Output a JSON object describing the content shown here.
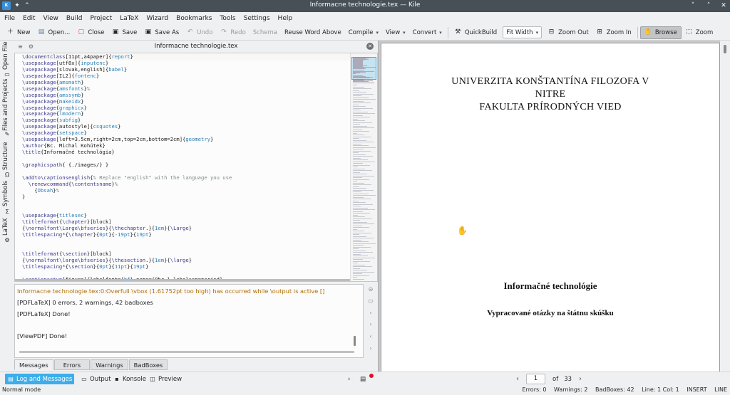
{
  "window": {
    "title": "Informacne technologie.tex — Kile",
    "app_icon": "K",
    "pin_icon": "✦",
    "up_icon": "⌃",
    "controls": [
      "˅",
      "˄",
      "✕"
    ]
  },
  "menu": [
    "File",
    "Edit",
    "View",
    "Build",
    "Project",
    "LaTeX",
    "Wizard",
    "Bookmarks",
    "Tools",
    "Settings",
    "Help"
  ],
  "toolbar": {
    "new": "New",
    "open": "Open...",
    "close": "Close",
    "save": "Save",
    "save_as": "Save As",
    "undo": "Undo",
    "redo": "Redo",
    "schema": "Schema",
    "reuse_word_above": "Reuse Word Above",
    "compile": "Compile",
    "view": "View",
    "convert": "Convert",
    "quickbuild": "QuickBuild",
    "fit_width": "Fit Width",
    "zoom_out": "Zoom Out",
    "zoom_in": "Zoom In",
    "browse": "Browse",
    "zoom": "Zoom"
  },
  "side_tabs": [
    "Open File",
    "Files and Projects",
    "Structure",
    "Symbols",
    "LaTeX"
  ],
  "editor": {
    "tab_title": "Informacne technologie.tex"
  },
  "code_lines": [
    "\\documentclass[11pt,a4paper]{report}",
    "\\usepackage[utf8x]{inputenc}",
    "\\usepackage[slovak,english]{babel}",
    "\\usepackage[IL2]{fontenc}",
    "\\usepackage{amsmath}",
    "\\usepackage{amsfonts}%",
    "\\usepackage{amssymb}",
    "\\usepackage{makeidx}",
    "\\usepackage{graphicx}",
    "\\usepackage{lmodern}",
    "\\usepackage{subfig}",
    "\\usepackage[autostyle]{csquotes}",
    "\\usepackage{setspace}",
    "\\usepackage[left=3.5cm,right=2cm,top=2cm,bottom=2cm]{geometry}",
    "\\author{Bc. Michal Kohútek}",
    "\\title{Informačné technológia}",
    "",
    "\\graphicspath{ {./images/} }",
    "",
    "\\addto\\captionsenglish{% Replace \"english\" with the language you use",
    "  \\renewcommand{\\contentsname}%",
    "    {Obsah}%",
    "}",
    "",
    "",
    "\\usepackage{titlesec}",
    "\\titleformat{\\chapter}[block]",
    "{\\normalfont\\Large\\bfseries}{\\thechapter.}{1em}{\\Large}",
    "\\titlespacing*{\\chapter}{0pt}{-19pt}{19pt}",
    "",
    "",
    "\\titleformat{\\section}[block]",
    "{\\normalfont\\large\\bfseries}{\\thesection.}{1em}{\\large}",
    "\\titlespacing*{\\section}{0pt}{11pt}{19pt}",
    "",
    "\\captionsetup[figure]{labelfont={bf},name={Obr.},labelsep=period}"
  ],
  "log": {
    "lines": [
      "Informacne technologie.tex:0:Overfull \\vbox (1.61752pt too high) has occurred while \\output is active []",
      "[PDFLaTeX] 0 errors, 2 warnings, 42 badboxes",
      "[PDFLaTeX] Done!",
      "",
      "[ViewPDF] Done!"
    ],
    "tabs": [
      "Messages",
      "Errors",
      "Warnings",
      "BadBoxes"
    ]
  },
  "bottom_views": [
    "Log and Messages",
    "Output",
    "Konsole",
    "Preview"
  ],
  "pager": {
    "current": "1",
    "of_label": "of",
    "total": "33"
  },
  "status": {
    "mode": "Normal mode",
    "errors": "Errors: 0",
    "warnings": "Warnings: 2",
    "badboxes": "BadBoxes: 42",
    "position": "Line: 1 Col: 1",
    "insert": "INSERT",
    "line_mode": "LINE"
  },
  "pdf": {
    "university_lines": [
      "UNIVERZITA KONŠTANTÍNA FILOZOFA V",
      "NITRE",
      "FAKULTA PRÍRODNÝCH VIED"
    ],
    "title": "Informačné technológie",
    "subtitle": "Vypracované otázky na štátnu skúšku"
  }
}
